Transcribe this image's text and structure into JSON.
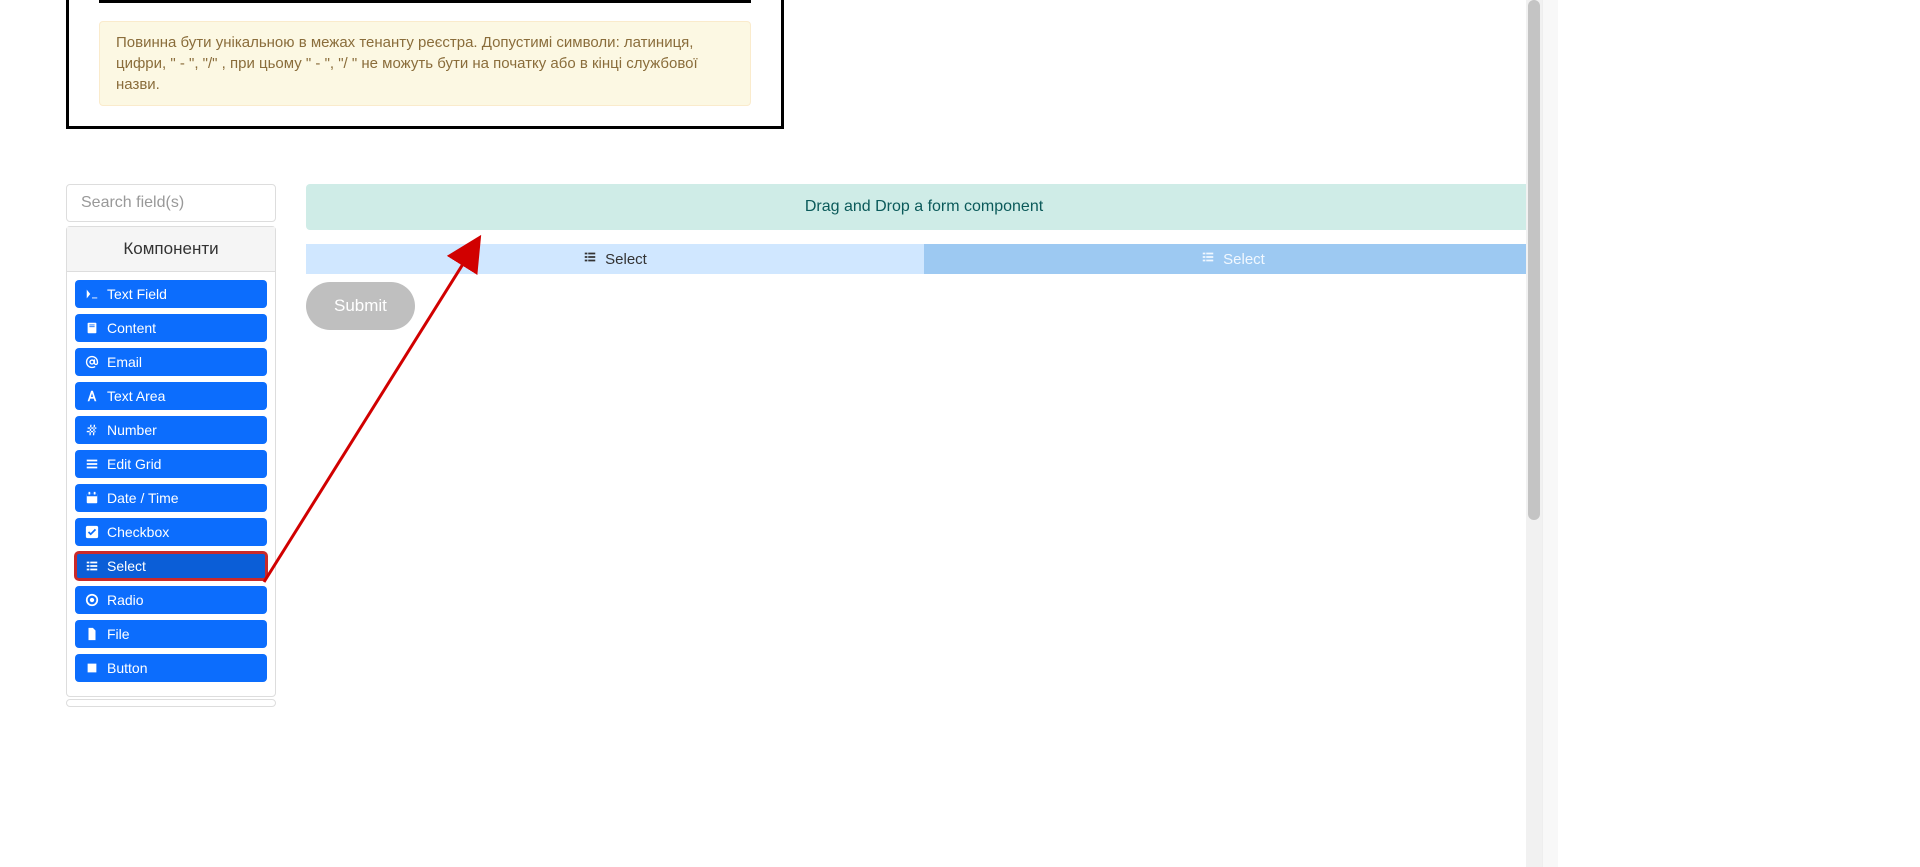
{
  "topInfo": {
    "message": "Повинна бути унікальною в межах тенанту реєстра. Допустимі символи: латиниця, цифри, \" - \", \"/\" , при цьому  \" - \", \"/ \" не можуть бути на початку або в кінці службової назви."
  },
  "sidebar": {
    "searchPlaceholder": "Search field(s)",
    "groupTitle": "Компоненти",
    "components": [
      {
        "icon": "terminal",
        "label": "Text Field"
      },
      {
        "icon": "doc",
        "label": "Content"
      },
      {
        "icon": "at",
        "label": "Email"
      },
      {
        "icon": "font",
        "label": "Text Area"
      },
      {
        "icon": "hash",
        "label": "Number"
      },
      {
        "icon": "grid",
        "label": "Edit Grid"
      },
      {
        "icon": "calendar",
        "label": "Date / Time"
      },
      {
        "icon": "check",
        "label": "Checkbox"
      },
      {
        "icon": "list",
        "label": "Select"
      },
      {
        "icon": "dot",
        "label": "Radio"
      },
      {
        "icon": "file",
        "label": "File"
      },
      {
        "icon": "stop",
        "label": "Button"
      }
    ]
  },
  "canvas": {
    "dropHint": "Drag and Drop a form component",
    "placedLabel": "Select",
    "ghostLabel": "Select",
    "submitLabel": "Submit"
  },
  "annotation": {
    "color": "#d10000"
  }
}
